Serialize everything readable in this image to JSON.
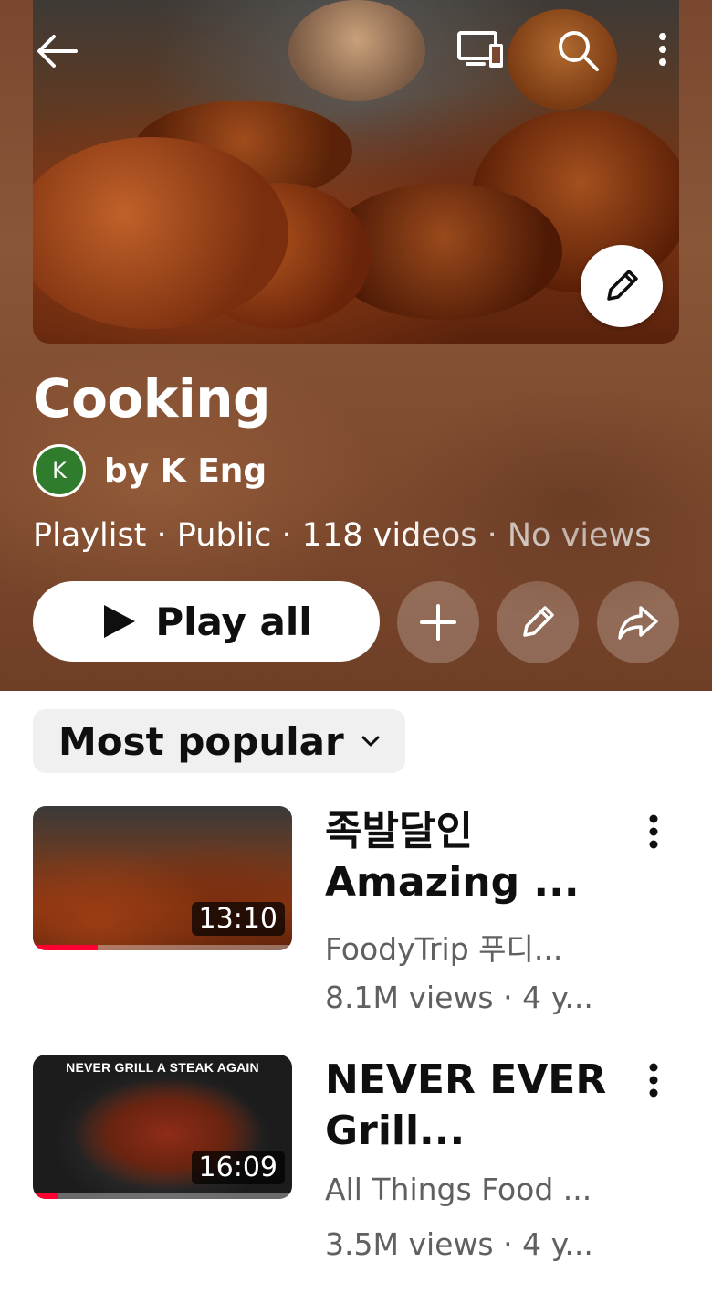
{
  "top_bar": {
    "back_icon": "arrow-left-icon",
    "cast_icon": "cast-icon",
    "search_icon": "search-icon",
    "more_icon": "more-vertical-icon",
    "thumbnail_edit_icon": "pencil-icon"
  },
  "playlist": {
    "title": "Cooking",
    "owner_initial": "K",
    "owner_name": "by K Eng",
    "meta": "Playlist · Public · 118 videos · No views",
    "avatar_color": "#2f7d2c"
  },
  "actions": {
    "play_all_label": "Play all",
    "add_icon": "plus-icon",
    "edit_icon": "pencil-icon",
    "share_icon": "share-icon"
  },
  "sort": {
    "label": "Most popular",
    "icon": "chevron-down-icon"
  },
  "videos": [
    {
      "title": "족발달인 Amazing ...",
      "channel": "FoodyTrip 푸디...",
      "stats": "8.1M views · 4 y...",
      "duration": "13:10",
      "watched_fraction": 0.25
    },
    {
      "title": "NEVER EVER Grill...",
      "channel": "All Things Food ...",
      "stats": "3.5M views · 4 y...",
      "duration": "16:09",
      "thumbnail_text": "NEVER GRILL A STEAK AGAIN",
      "watched_fraction": 0.1
    }
  ],
  "colors": {
    "header_bg": "#7e4a2e",
    "progress": "#ff0033",
    "secondary_text": "#606060"
  }
}
